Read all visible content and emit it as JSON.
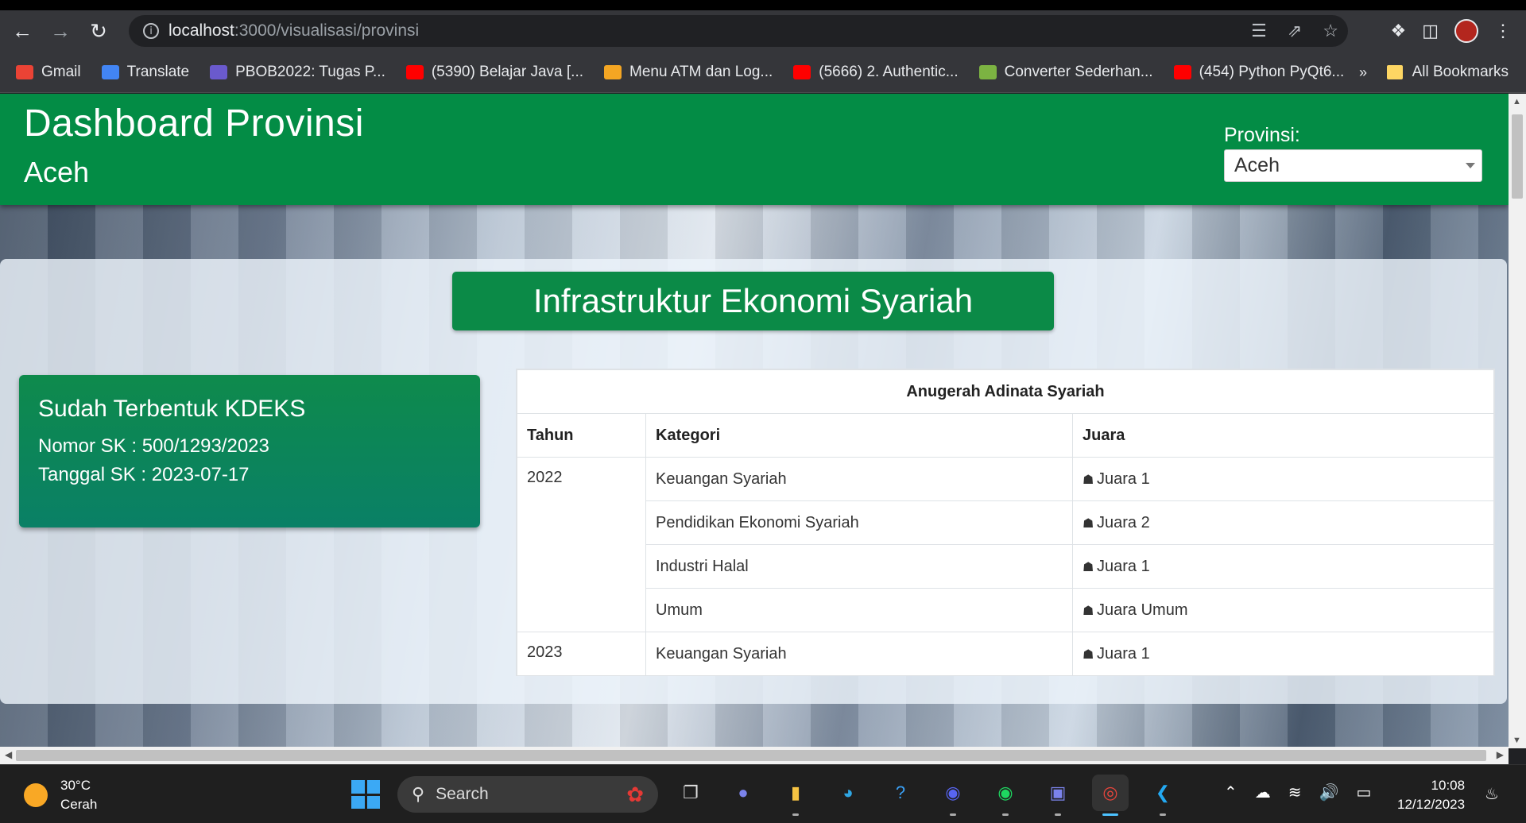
{
  "browser": {
    "url_host": "localhost",
    "url_path": ":3000/visualisasi/provinsi",
    "bookmarks": [
      {
        "label": "Gmail",
        "icon": "gmail-icon",
        "color": "#ea4335"
      },
      {
        "label": "Translate",
        "icon": "translate-icon",
        "color": "#4285f4"
      },
      {
        "label": "PBOB2022: Tugas P...",
        "icon": "pbob-icon",
        "color": "#6a5acd"
      },
      {
        "label": "(5390) Belajar Java [...",
        "icon": "youtube-icon",
        "color": "#ff0000"
      },
      {
        "label": "Menu ATM dan Log...",
        "icon": "box-icon",
        "color": "#f4a623"
      },
      {
        "label": "(5666) 2. Authentic...",
        "icon": "youtube-icon",
        "color": "#ff0000"
      },
      {
        "label": "Converter Sederhan...",
        "icon": "cube-icon",
        "color": "#7cb342"
      },
      {
        "label": "(454) Python PyQt6...",
        "icon": "youtube-icon",
        "color": "#ff0000"
      }
    ],
    "more_label": "»",
    "all_bookmarks_label": "All Bookmarks"
  },
  "header": {
    "title": "Dashboard Provinsi",
    "subtitle": "Aceh",
    "province_label": "Provinsi:",
    "province_selected": "Aceh"
  },
  "section": {
    "title": "Infrastruktur Ekonomi Syariah"
  },
  "kdeks_card": {
    "title": "Sudah Terbentuk KDEKS",
    "nomor_sk": "Nomor SK : 500/1293/2023",
    "tanggal_sk": "Tanggal SK : 2023-07-17"
  },
  "award_table": {
    "caption": "Anugerah Adinata Syariah",
    "headers": [
      "Tahun",
      "Kategori",
      "Juara"
    ],
    "groups": [
      {
        "year": "2022",
        "rows": [
          {
            "kategori": "Keuangan Syariah",
            "juara": "Juara 1"
          },
          {
            "kategori": "Pendidikan Ekonomi Syariah",
            "juara": "Juara 2"
          },
          {
            "kategori": "Industri Halal",
            "juara": "Juara 1"
          },
          {
            "kategori": "Umum",
            "juara": "Juara Umum"
          }
        ]
      },
      {
        "year": "2023",
        "rows": [
          {
            "kategori": "Keuangan Syariah",
            "juara": "Juara 1"
          }
        ]
      }
    ]
  },
  "taskbar": {
    "temperature": "30°C",
    "weather": "Cerah",
    "search_placeholder": "Search",
    "time": "10:08",
    "date": "12/12/2023"
  }
}
